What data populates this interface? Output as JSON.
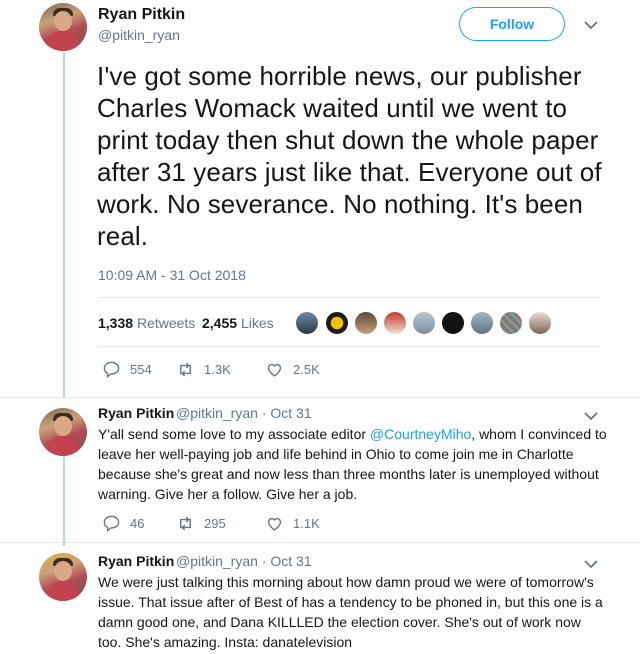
{
  "main": {
    "name": "Ryan Pitkin",
    "handle": "@pitkin_ryan",
    "follow_label": "Follow",
    "text": "I've got some horrible news, our publisher Charles Womack waited until we went to print today then shut down the whole paper after 31 years just like that. Everyone out of work. No severance. No nothing. It's been real.",
    "timestamp": "10:09 AM - 31 Oct 2018",
    "retweets_count": "1,338",
    "retweets_label": "Retweets",
    "likes_count": "2,455",
    "likes_label": "Likes",
    "actions": {
      "replies": "554",
      "retweets": "1.3K",
      "likes": "2.5K"
    }
  },
  "replies": [
    {
      "name": "Ryan Pitkin",
      "handle": "@pitkin_ryan",
      "date": "· Oct 31",
      "text_before": "Y'all send some love to my associate editor ",
      "mention": "@CourtneyMiho",
      "text_after": ", whom I convinced to leave her well-paying job and life behind in Ohio to come join me in Charlotte because she's great and now less than three months later is unemployed without warning. Give her a follow. Give her a job.",
      "actions": {
        "replies": "46",
        "retweets": "295",
        "likes": "1.1K"
      }
    },
    {
      "name": "Ryan Pitkin",
      "handle": "@pitkin_ryan",
      "date": "· Oct 31",
      "text": "We were just talking this morning about how damn proud we were of tomorrow's issue. That issue after of Best of has a tendency to be phoned in, but this one is a damn good one, and Dana KILLLED the election cover. She's out of work now too. She's amazing. Insta: danatelevision"
    }
  ],
  "colors": {
    "accent": "#1da1f2",
    "text": "#14171a",
    "muted": "#657786",
    "thread": "#a7dcf5",
    "like_pink": "#e0245e"
  }
}
